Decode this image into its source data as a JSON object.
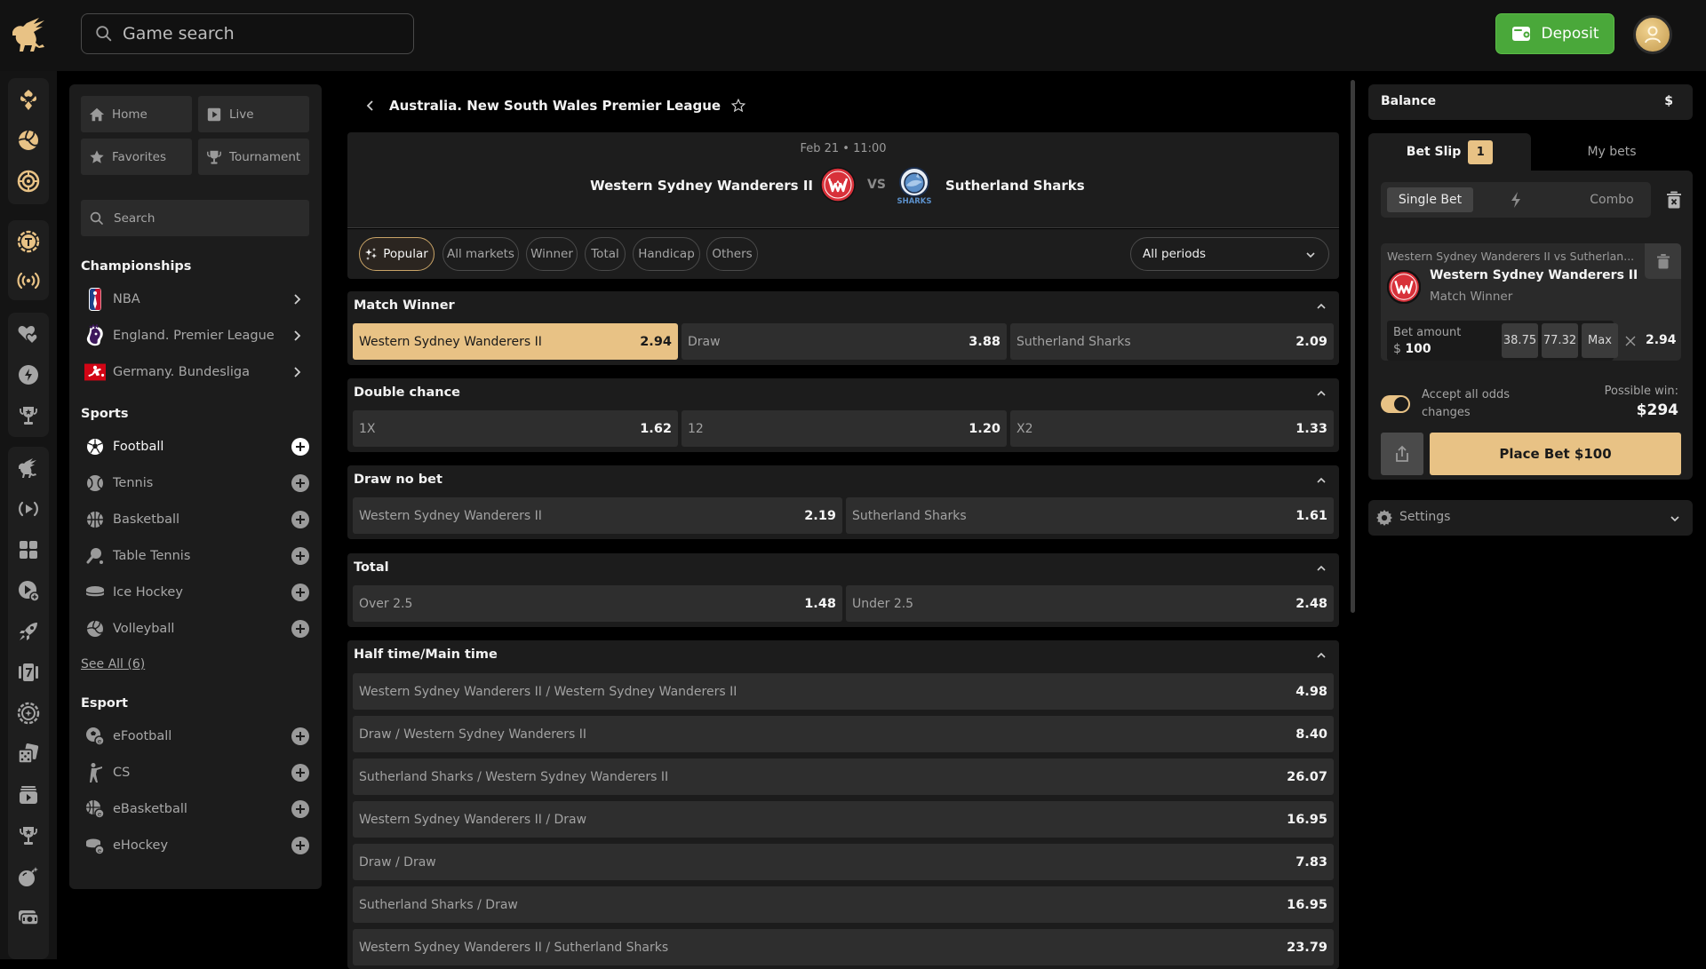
{
  "topbar": {
    "search_placeholder": "Game search",
    "deposit_label": "Deposit"
  },
  "rail": {
    "icons": [
      "casino-icon",
      "volleyball-icon",
      "roulette-icon",
      "tournament-token-icon",
      "live-broadcast-icon",
      "favorites-hearts-icon",
      "lightning-icon",
      "trophy-star-icon",
      "lion-logo-icon",
      "live-play-icon",
      "grid-icon",
      "video-add-icon",
      "rocket-icon",
      "slot-seven-icon",
      "chip-icon",
      "dice-icon",
      "tv-play-icon",
      "trophy-icon",
      "bomb-icon",
      "cash-icon"
    ]
  },
  "leftnav": {
    "quick": [
      {
        "label": "Home",
        "icon": "home-icon"
      },
      {
        "label": "Live",
        "icon": "live-play-icon"
      },
      {
        "label": "Favorites",
        "icon": "star-icon"
      },
      {
        "label": "Tournament",
        "icon": "trophy-icon"
      }
    ],
    "search_placeholder": "Search",
    "championships_heading": "Championships",
    "championships": [
      {
        "label": "NBA",
        "icon": "nba-logo-icon"
      },
      {
        "label": "England. Premier League",
        "icon": "premier-league-logo-icon"
      },
      {
        "label": "Germany. Bundesliga",
        "icon": "bundesliga-logo-icon"
      }
    ],
    "sports_heading": "Sports",
    "sports": [
      {
        "label": "Football",
        "icon": "football-icon",
        "active": true
      },
      {
        "label": "Tennis",
        "icon": "tennis-icon"
      },
      {
        "label": "Basketball",
        "icon": "basketball-icon"
      },
      {
        "label": "Table Tennis",
        "icon": "table-tennis-icon"
      },
      {
        "label": "Ice Hockey",
        "icon": "ice-hockey-icon"
      },
      {
        "label": "Volleyball",
        "icon": "volleyball-icon"
      }
    ],
    "see_all": "See All (6)",
    "esport_heading": "Esport",
    "esports": [
      {
        "label": "eFootball",
        "icon": "efootball-icon"
      },
      {
        "label": "CS",
        "icon": "cs-soldier-icon"
      },
      {
        "label": "eBasketball",
        "icon": "ebasketball-icon"
      },
      {
        "label": "eHockey",
        "icon": "ehockey-icon"
      }
    ]
  },
  "main": {
    "league_title": "Australia. New South Wales Premier League",
    "event": {
      "datetime": "Feb 21 • 11:00",
      "home": "Western Sydney Wanderers II",
      "vs": "VS",
      "away": "Sutherland Sharks",
      "away_logo_text": "SHARKS"
    },
    "tabs": [
      "Popular",
      "All markets",
      "Winner",
      "Total",
      "Handicap",
      "Others"
    ],
    "active_tab": "Popular",
    "period_select": "All periods",
    "markets": [
      {
        "title": "Match Winner",
        "outcomes": [
          {
            "label": "Western Sydney Wanderers II",
            "odds": "2.94",
            "selected": true
          },
          {
            "label": "Draw",
            "odds": "3.88"
          },
          {
            "label": "Sutherland Sharks",
            "odds": "2.09"
          }
        ]
      },
      {
        "title": "Double chance",
        "outcomes": [
          {
            "label": "1X",
            "odds": "1.62"
          },
          {
            "label": "12",
            "odds": "1.20"
          },
          {
            "label": "X2",
            "odds": "1.33"
          }
        ]
      },
      {
        "title": "Draw no bet",
        "outcomes": [
          {
            "label": "Western Sydney Wanderers II",
            "odds": "2.19"
          },
          {
            "label": "Sutherland Sharks",
            "odds": "1.61"
          }
        ]
      },
      {
        "title": "Total",
        "outcomes": [
          {
            "label": "Over 2.5",
            "odds": "1.48"
          },
          {
            "label": "Under 2.5",
            "odds": "2.48"
          }
        ]
      },
      {
        "title": "Half time/Main time",
        "outcomes": [
          {
            "label": "Western Sydney Wanderers II / Western Sydney Wanderers II",
            "odds": "4.98"
          },
          {
            "label": "Draw / Western Sydney Wanderers II",
            "odds": "8.40"
          },
          {
            "label": "Sutherland Sharks / Western Sydney Wanderers II",
            "odds": "26.07"
          },
          {
            "label": "Western Sydney Wanderers II / Draw",
            "odds": "16.95"
          },
          {
            "label": "Draw / Draw",
            "odds": "7.83"
          },
          {
            "label": "Sutherland Sharks / Draw",
            "odds": "16.95"
          },
          {
            "label": "Western Sydney Wanderers II / Sutherland Sharks",
            "odds": "23.79"
          }
        ]
      }
    ]
  },
  "betslip": {
    "balance_label": "Balance",
    "balance_currency": "$",
    "tab_betslip": "Bet Slip",
    "betslip_count": "1",
    "tab_mybets": "My bets",
    "mode_single": "Single Bet",
    "mode_combo": "Combo",
    "bet": {
      "match": "Western Sydney Wanderers II vs Sutherlan...",
      "selection": "Western Sydney Wanderers II",
      "market": "Match Winner",
      "amount_label": "Bet amount",
      "currency": "$",
      "amount": "100",
      "quick_amounts": [
        "38.75",
        "77.32",
        "Max"
      ],
      "odds": "2.94"
    },
    "accept_odds_label": "Accept all odds changes",
    "accept_odds_on": true,
    "possible_win_label": "Possible win:",
    "possible_win": "$294",
    "place_bet_label": "Place Bet $100",
    "settings_label": "Settings"
  },
  "colors": {
    "accent": "#e8c285",
    "deposit_green": "#4aa83a",
    "panel": "#1c1c1c",
    "odds_cell": "#2e2e2e",
    "wanderers_red": "#d8313a",
    "sharks_blue": "#5b8fc9"
  }
}
